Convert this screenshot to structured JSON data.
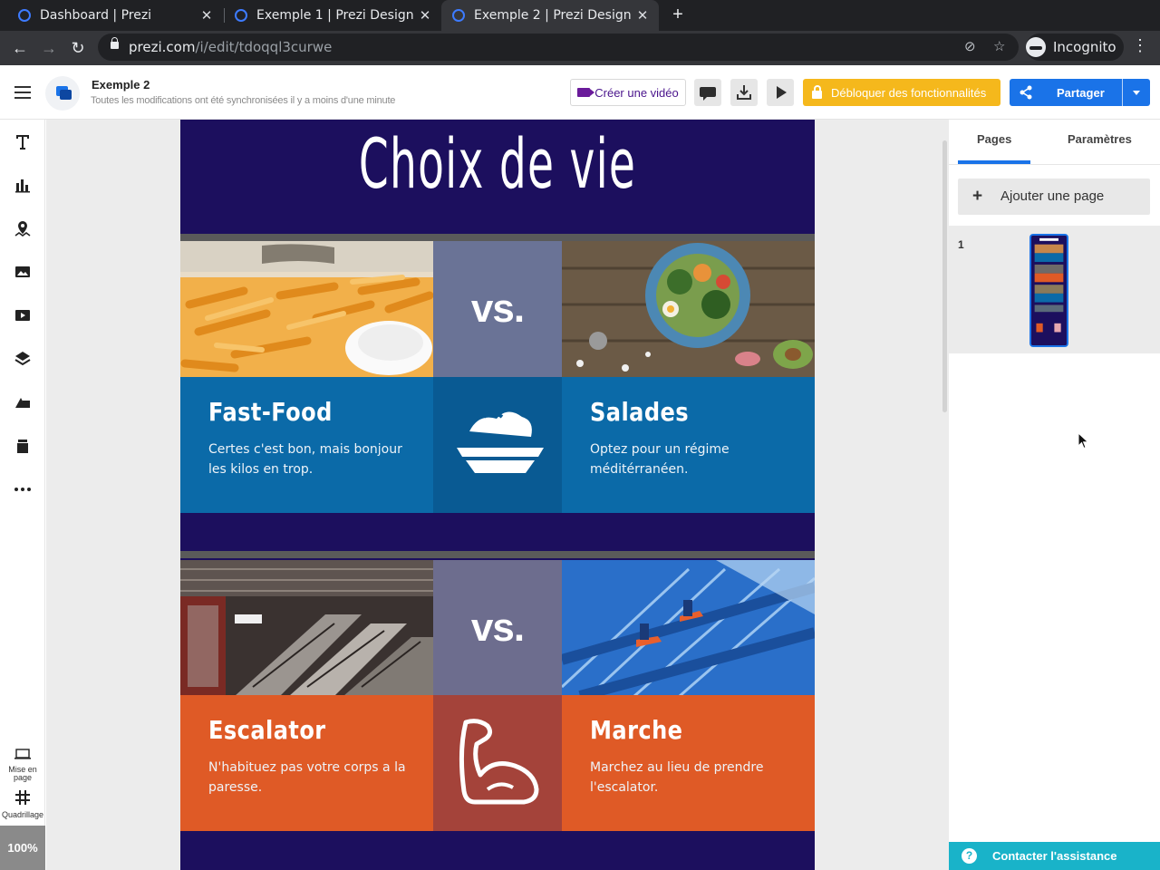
{
  "browser": {
    "tabs": [
      {
        "title": "Dashboard | Prezi",
        "close": "✕"
      },
      {
        "title": "Exemple 1 | Prezi Design",
        "close": "✕"
      },
      {
        "title": "Exemple 2 | Prezi Design",
        "close": "✕"
      }
    ],
    "new_tab": "+",
    "url_host": "prezi.com",
    "url_path": "/i/edit/tdoqql3curwe",
    "profile": "Incognito"
  },
  "header": {
    "doc_title": "Exemple 2",
    "sync_status": "Toutes les modifications ont été synchronisées il y a moins d'une minute",
    "create_video": "Créer une vidéo",
    "unlock": "Débloquer des fonctionnalités",
    "share": "Partager"
  },
  "rail": {
    "layout_label_1": "Mise en",
    "layout_label_2": "page",
    "grid_label": "Quadrillage",
    "zoom": "100%"
  },
  "slide": {
    "title": "Choix de vie",
    "vs": "vs.",
    "row1": {
      "left_title": "Fast-Food",
      "left_text": "Certes c'est bon, mais bonjour les kilos en trop.",
      "right_title": "Salades",
      "right_text": "Optez pour un régime méditérranéen."
    },
    "row2": {
      "left_title": "Escalator",
      "left_text": "N'habituez pas votre corps a la paresse.",
      "right_title": "Marche",
      "right_text": "Marchez au lieu de prendre l'escalator."
    }
  },
  "panel": {
    "tab_pages": "Pages",
    "tab_settings": "Paramètres",
    "add_page": "Ajouter une page",
    "page_number": "1",
    "help": "Contacter l'assistance"
  },
  "colors": {
    "slide_bg": "#1c0f5e",
    "blue_cell": "#0b6aa8",
    "blue_mid": "#095a93",
    "orange_cell": "#df5a26",
    "orange_mid": "#a4433a",
    "vs_top": "#6a7396",
    "vs_bottom": "#6d6d8e",
    "accent": "#1a73e8",
    "unlock": "#f5b81c",
    "help": "#19b3c9"
  }
}
